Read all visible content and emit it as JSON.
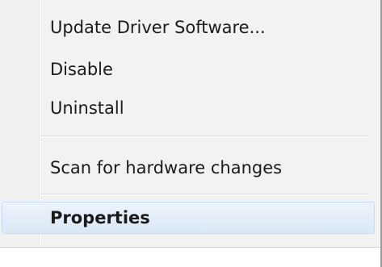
{
  "context_menu": {
    "items": [
      {
        "label": "Update Driver Software...",
        "bold": false
      },
      {
        "label": "Disable",
        "bold": false
      },
      {
        "label": "Uninstall",
        "bold": false
      },
      {
        "label": "Scan for hardware changes",
        "bold": false
      },
      {
        "label": "Properties",
        "bold": true,
        "highlighted": true
      }
    ],
    "colors": {
      "background": "#f2f2f2",
      "highlight_top": "#eef4fb",
      "highlight_bottom": "#dbe8f7",
      "highlight_border": "#c6dbf2",
      "text": "#1a1a1a"
    }
  }
}
